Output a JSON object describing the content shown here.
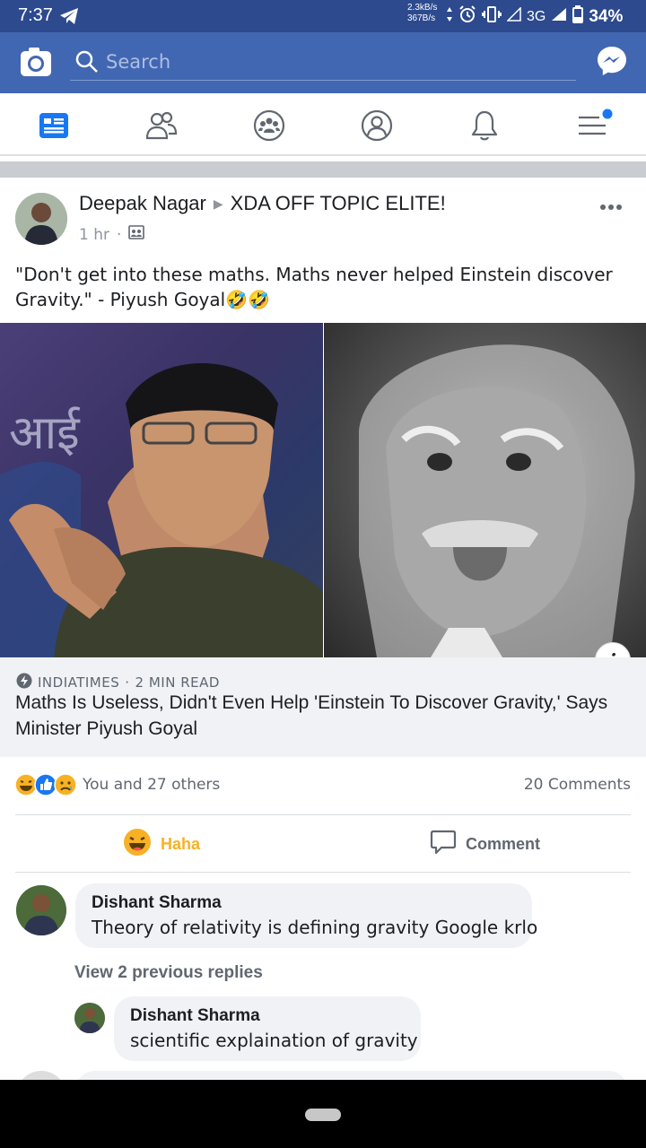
{
  "status_bar": {
    "time": "7:37",
    "speed_up": "2.3kB/s",
    "speed_down": "367B/s",
    "network": "3G",
    "battery": "34%",
    "icons": [
      "telegram-icon",
      "alarm-icon",
      "vibrate-icon",
      "signal-icon",
      "battery-icon"
    ]
  },
  "header": {
    "search_placeholder": "Search",
    "brand_color": "#4267b2"
  },
  "nav_tabs": [
    "news-feed-icon",
    "friends-icon",
    "groups-icon",
    "profile-icon",
    "notifications-icon",
    "menu-icon"
  ],
  "post": {
    "author": "Deepak Nagar",
    "group": "XDA OFF TOPIC ELITE!",
    "time": "1 hr",
    "text": "\"Don't get into these maths. Maths never helped Einstein discover Gravity.\" - Piyush Goyal🤣🤣",
    "link": {
      "source": "INDIATIMES",
      "read_time": "2 MIN READ",
      "headline": "Maths Is Useless, Didn't Even Help 'Einstein To Discover Gravity,' Says Minister Piyush Goyal"
    },
    "reactions": {
      "summary": "You and 27 others",
      "comments_count": "20 Comments"
    },
    "actions": {
      "haha": "Haha",
      "comment": "Comment"
    }
  },
  "comments": [
    {
      "name": "Dishant Sharma",
      "text": "Theory of relativity is defining gravity Google krlo"
    }
  ],
  "view_replies": "View 2 previous replies",
  "replies": [
    {
      "name": "Dishant Sharma",
      "text": "scientific explaination of gravity"
    }
  ]
}
